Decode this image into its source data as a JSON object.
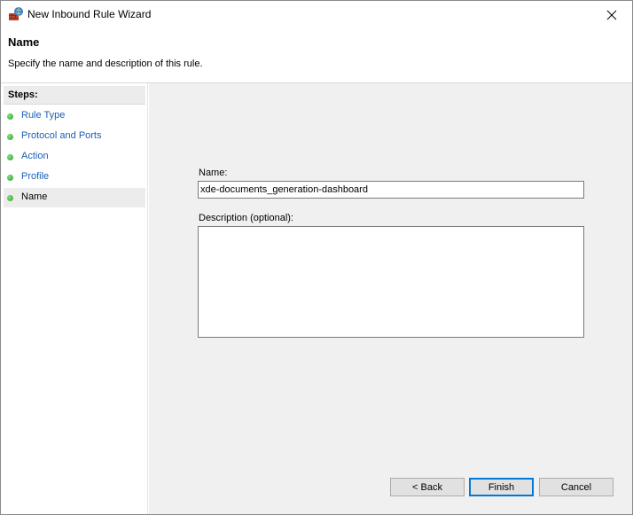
{
  "window": {
    "title": "New Inbound Rule Wizard"
  },
  "header": {
    "title": "Name",
    "description": "Specify the name and description of this rule."
  },
  "steps": {
    "label": "Steps:",
    "items": [
      {
        "label": "Rule Type",
        "current": false
      },
      {
        "label": "Protocol and Ports",
        "current": false
      },
      {
        "label": "Action",
        "current": false
      },
      {
        "label": "Profile",
        "current": false
      },
      {
        "label": "Name",
        "current": true
      }
    ]
  },
  "form": {
    "name_label": "Name:",
    "name_value": "xde-documents_generation-dashboard",
    "description_label": "Description (optional):",
    "description_value": ""
  },
  "buttons": {
    "back": "< Back",
    "finish": "Finish",
    "cancel": "Cancel"
  },
  "colors": {
    "link": "#1a5fb4",
    "step_dot": "#2fa02b",
    "focus_border": "#0078d7",
    "content_bg": "#f0f0f0"
  },
  "icons": {
    "app": "firewall-wizard-icon",
    "close": "close-icon",
    "step": "green-dot-icon"
  }
}
